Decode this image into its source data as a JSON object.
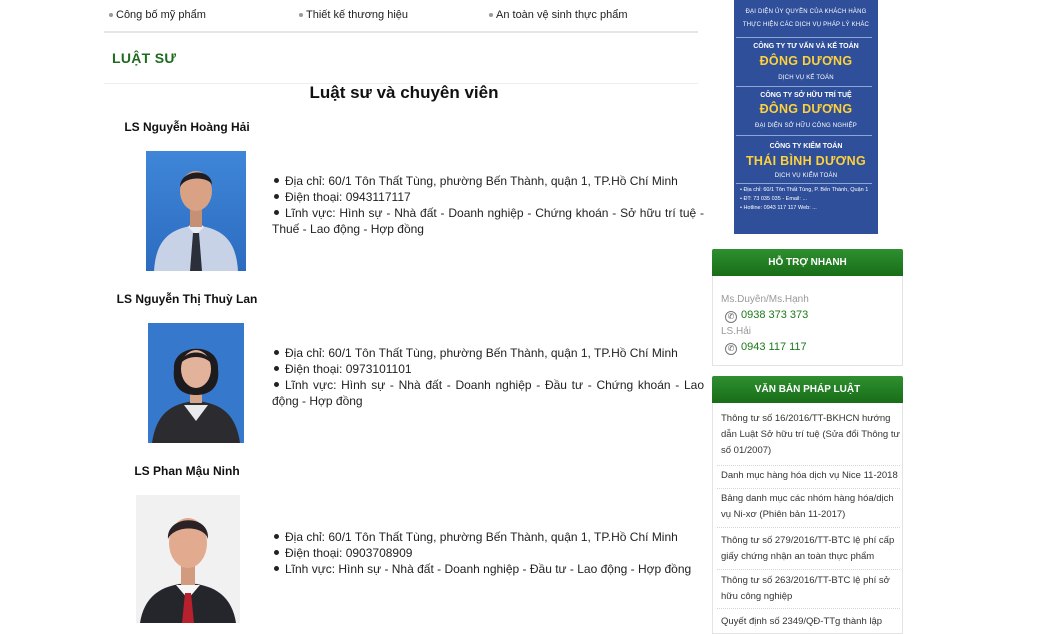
{
  "top_links": [
    "Công bố mỹ phẩm",
    "Thiết kế thương hiệu",
    "An toàn vệ sinh thực phẩm"
  ],
  "section_title": "LUẬT SƯ",
  "page_heading": "Luật sư và chuyên viên",
  "lawyers": [
    {
      "name": "LS Nguyễn Hoàng Hải",
      "address": "Địa chỉ: 60/1 Tôn Thất Tùng, phường Bến Thành, quận 1, TP.Hồ Chí Minh",
      "phone": "Điện thoại: 0943117117",
      "fields": "Lĩnh vực: Hình sự - Nhà đất - Doanh nghiệp - Chứng khoán - Sở hữu trí tuệ - Thuế - Lao động - Hợp đồng"
    },
    {
      "name": "LS Nguyễn Thị Thuỳ Lan",
      "address": "Địa chỉ: 60/1 Tôn Thất Tùng, phường Bến Thành, quận 1, TP.Hồ Chí Minh",
      "phone": "Điện thoại: 0973101101",
      "fields": "Lĩnh vực: Hình sự - Nhà đất - Doanh nghiệp - Đầu tư - Chứng khoán - Lao động - Hợp đồng"
    },
    {
      "name": "LS Phan Mậu Ninh",
      "address": "Địa chỉ: 60/1 Tôn Thất Tùng, phường Bến Thành, quận 1, TP.Hồ Chí Minh",
      "phone": "Điện thoại: 0903708909",
      "fields": "Lĩnh vực: Hình sự - Nhà đất - Doanh nghiệp - Đầu tư - Lao động - Hợp đồng"
    }
  ],
  "banner": {
    "line_top": "ĐẠI DIỆN ỦY QUYỀN CỦA KHÁCH HÀNG",
    "line_top2": "THỰC HIỆN CÁC DỊCH VỤ PHÁP LÝ KHÁC",
    "companies": [
      {
        "company": "CÔNG TY TƯ VẤN VÀ KẾ TOÁN",
        "brand": "ĐÔNG DƯƠNG",
        "service": "DỊCH VỤ KẾ TOÁN"
      },
      {
        "company": "CÔNG TY SỞ HỮU TRÍ TUỆ",
        "brand": "ĐÔNG DƯƠNG",
        "service": "ĐẠI DIỆN SỞ HỮU CÔNG NGHIỆP"
      },
      {
        "company": "CÔNG TY KIỂM TOÁN",
        "brand": "THÁI BÌNH DƯƠNG",
        "service": "DỊCH VỤ KIỂM TOÁN"
      }
    ],
    "footer_address": "• Địa chỉ: 60/1 Tôn Thất Tùng, P. Bến Thành, Quận 1",
    "footer_phone": "• ĐT: 73 035 035 -  Email: ...",
    "footer_hotline": "• Hotline: 0943 117 117      Web: ..."
  },
  "support": {
    "title": "HỖ TRỢ NHANH",
    "contacts": [
      {
        "name": "Ms.Duyên/Ms.Hạnh",
        "phone": "0938 373 373"
      },
      {
        "name": "LS.Hải",
        "phone": "0943 117 117"
      }
    ]
  },
  "laws": {
    "title": "VĂN BẢN PHÁP LUẬT",
    "items": [
      "Thông tư số 16/2016/TT-BKHCN hướng dẫn Luật Sở hữu trí tuệ (Sửa đổi Thông tư số 01/2007)",
      "Danh mục hàng hóa dịch vụ Nice 11-2018",
      "Bảng danh mục các nhóm hàng hóa/dịch vụ Ni-xơ (Phiên bản 11-2017)",
      "Thông tư số 279/2016/TT-BTC lệ phí cấp giấy chứng nhận an toàn thực phẩm",
      "Thông tư số 263/2016/TT-BTC lệ phí sở hữu công nghiệp",
      "Quyết định số 2349/QĐ-TTg thành lập"
    ]
  }
}
